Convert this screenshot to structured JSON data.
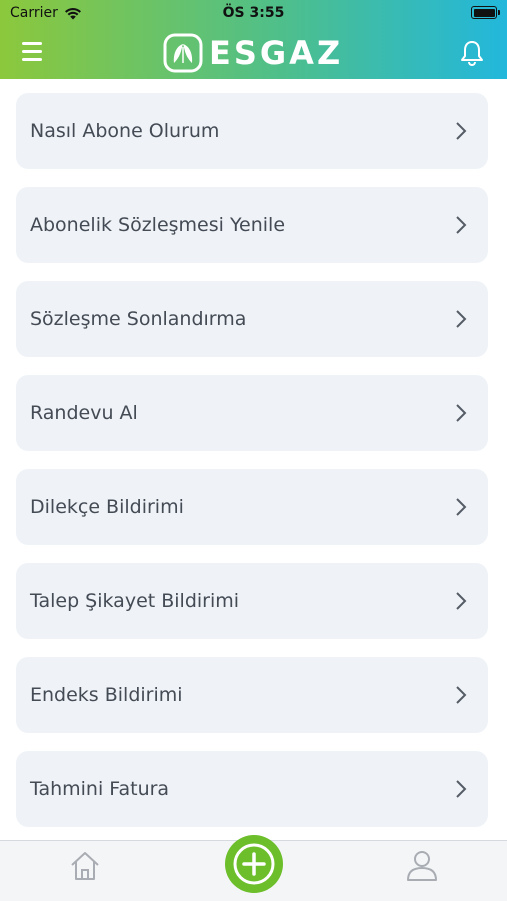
{
  "status_bar": {
    "carrier": "Carrier",
    "time": "ÖS 3:55"
  },
  "header": {
    "logo_text": "ESGAZ",
    "menu_icon": "hamburger-icon",
    "notification_icon": "bell-icon"
  },
  "menu": {
    "items": [
      {
        "label": "Nasıl Abone Olurum"
      },
      {
        "label": "Abonelik Sözleşmesi Yenile"
      },
      {
        "label": "Sözleşme Sonlandırma"
      },
      {
        "label": "Randevu Al"
      },
      {
        "label": "Dilekçe Bildirimi"
      },
      {
        "label": "Talep Şikayet Bildirimi"
      },
      {
        "label": "Endeks Bildirimi"
      },
      {
        "label": "Tahmini Fatura"
      }
    ]
  },
  "tab_bar": {
    "home_icon": "home-icon",
    "add_icon": "plus-circle-icon",
    "profile_icon": "user-icon"
  },
  "colors": {
    "header_start": "#8cc83c",
    "header_end": "#22b7dc",
    "accent_green": "#6cbe2b",
    "item_bg": "#eff3f7"
  }
}
